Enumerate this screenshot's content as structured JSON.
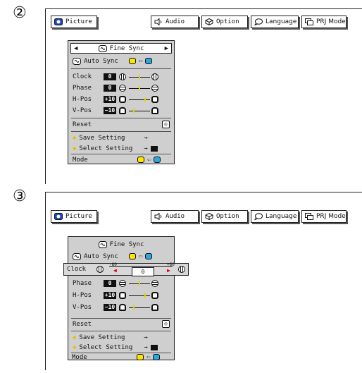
{
  "steps": [
    {
      "number": "②",
      "tabs": {
        "picture": "Picture",
        "audio": "Audio",
        "option": "Option",
        "language": "Language",
        "prj_mode": "PRJ Mode"
      },
      "menu": {
        "title": "Fine Sync",
        "auto_sync": "Auto Sync",
        "rows": [
          {
            "label": "Clock",
            "value": "0"
          },
          {
            "label": "Phase",
            "value": "0"
          },
          {
            "label": "H-Pos",
            "value": "+10"
          },
          {
            "label": "V-Pos",
            "value": "−10"
          }
        ],
        "reset": "Reset",
        "save_setting": "Save Setting",
        "select_setting": "Select Setting",
        "mode": "Mode"
      }
    },
    {
      "number": "③",
      "tabs": {
        "picture": "Picture",
        "audio": "Audio",
        "option": "Option",
        "language": "Language",
        "prj_mode": "PRJ Mode"
      },
      "menu": {
        "title": "Fine Sync",
        "auto_sync": "Auto Sync",
        "clock_popup": {
          "label": "Clock",
          "min": "-60",
          "max": "+60",
          "value": "0"
        },
        "rows": [
          {
            "label": "Phase",
            "value": "0"
          },
          {
            "label": "H-Pos",
            "value": "+10"
          },
          {
            "label": "V-Pos",
            "value": "−10"
          }
        ],
        "reset": "Reset",
        "save_setting": "Save Setting",
        "select_setting": "Select Setting",
        "mode": "Mode"
      }
    }
  ],
  "colors": {
    "menu_bg": "#cfcfcf",
    "accent_yellow": "#ffe600",
    "accent_blue": "#2aa8e0",
    "selected_bg": "#d8d8d8"
  }
}
